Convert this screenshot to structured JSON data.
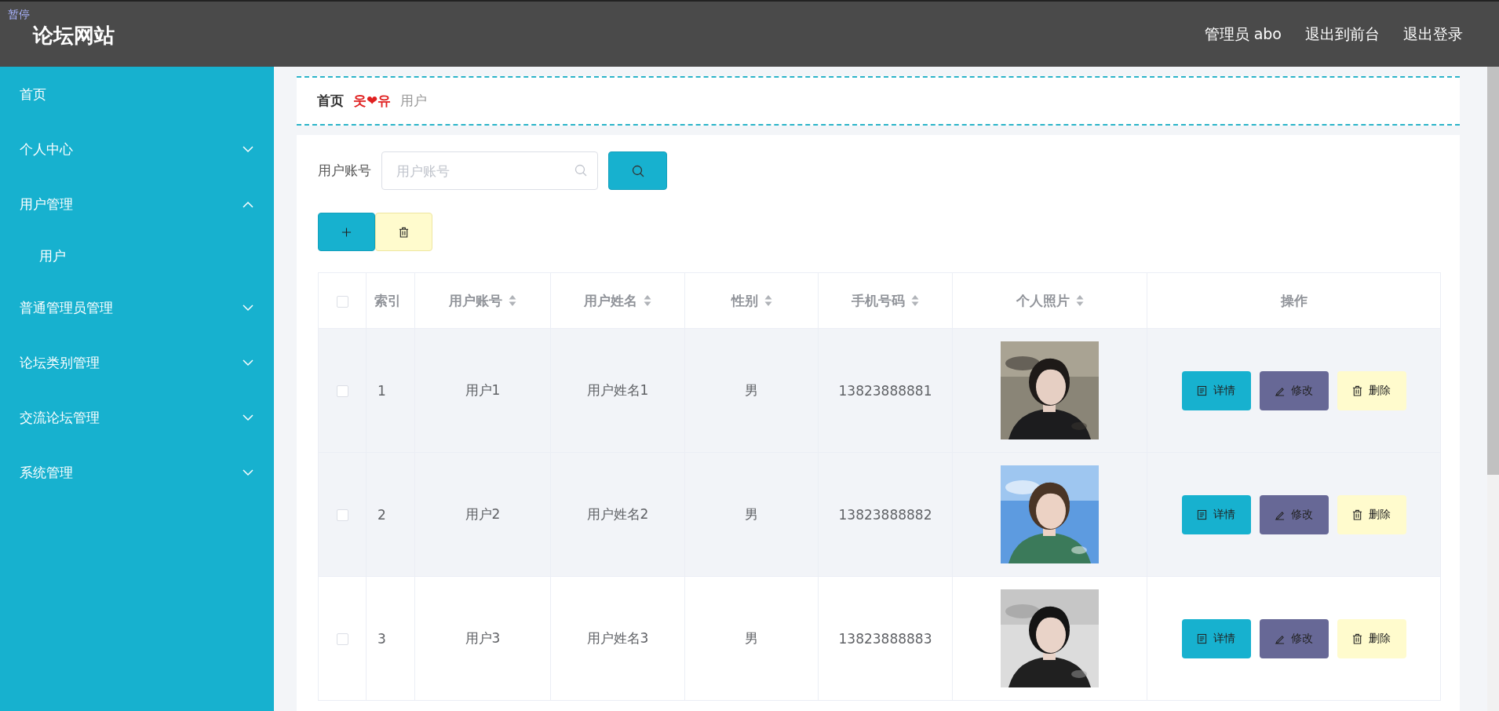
{
  "header": {
    "paused_label": "暂停",
    "title": "论坛网站",
    "links": [
      "管理员 abo",
      "退出到前台",
      "退出登录"
    ]
  },
  "sidebar": {
    "items": [
      {
        "label": "首页",
        "kind": "link"
      },
      {
        "label": "个人中心",
        "kind": "menu",
        "expanded": false
      },
      {
        "label": "用户管理",
        "kind": "menu",
        "expanded": true,
        "children": [
          {
            "label": "用户"
          }
        ]
      },
      {
        "label": "普通管理员管理",
        "kind": "menu",
        "expanded": false
      },
      {
        "label": "论坛类别管理",
        "kind": "menu",
        "expanded": false
      },
      {
        "label": "交流论坛管理",
        "kind": "menu",
        "expanded": false
      },
      {
        "label": "系统管理",
        "kind": "menu",
        "expanded": false
      }
    ]
  },
  "breadcrumb": {
    "home": "首页",
    "separator": "웃❤유",
    "current": "用户"
  },
  "search": {
    "label": "用户账号",
    "placeholder": "用户账号"
  },
  "table": {
    "select_all": {
      "checked": false
    },
    "columns": [
      {
        "label": "索引",
        "sortable": false
      },
      {
        "label": "用户账号",
        "sortable": true
      },
      {
        "label": "用户姓名",
        "sortable": true
      },
      {
        "label": "性别",
        "sortable": true
      },
      {
        "label": "手机号码",
        "sortable": true
      },
      {
        "label": "个人照片",
        "sortable": true
      },
      {
        "label": "操作",
        "sortable": false
      }
    ],
    "rows": [
      {
        "checked": false,
        "highlighted": true,
        "index": "1",
        "account": "用户1",
        "name": "用户姓名1",
        "gender": "男",
        "phone": "13823888881",
        "actions": [
          {
            "kind": "detail",
            "label": "详情"
          },
          {
            "kind": "edit",
            "label": "修改"
          },
          {
            "kind": "delete",
            "label": "删除"
          }
        ]
      },
      {
        "checked": false,
        "highlighted": true,
        "index": "2",
        "account": "用户2",
        "name": "用户姓名2",
        "gender": "男",
        "phone": "13823888882",
        "actions": [
          {
            "kind": "detail",
            "label": "详情"
          },
          {
            "kind": "edit",
            "label": "修改"
          },
          {
            "kind": "delete",
            "label": "删除"
          }
        ]
      },
      {
        "checked": false,
        "highlighted": false,
        "index": "3",
        "account": "用户3",
        "name": "用户姓名3",
        "gender": "男",
        "phone": "13823888883",
        "actions": [
          {
            "kind": "detail",
            "label": "详情"
          },
          {
            "kind": "edit",
            "label": "修改"
          },
          {
            "kind": "delete",
            "label": "删除"
          }
        ]
      }
    ]
  }
}
